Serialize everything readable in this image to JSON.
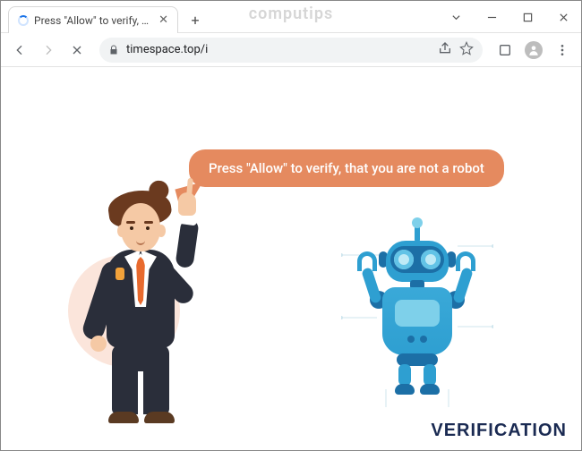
{
  "window": {
    "watermark": "computips"
  },
  "tab": {
    "title": "Press \"Allow\" to verify, that you a"
  },
  "toolbar": {
    "url": "timespace.top/i"
  },
  "page": {
    "bubble_text": "Press \"Allow\" to verify, that you are not a robot",
    "footer": "VERIFICATION"
  },
  "colors": {
    "accent": "#e58a5f",
    "robot_primary": "#2e9fd1",
    "footer_text": "#1a2a52"
  }
}
